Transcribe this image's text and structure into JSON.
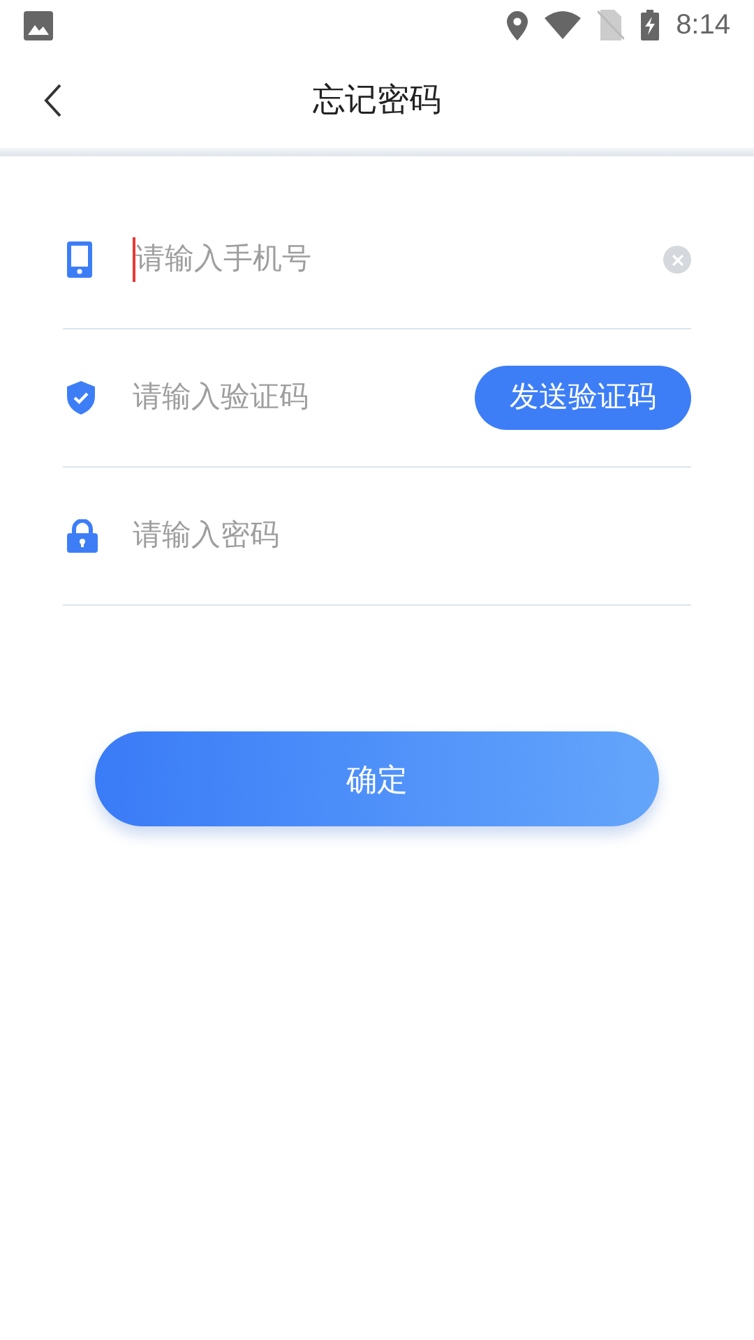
{
  "status_bar": {
    "time": "8:14"
  },
  "header": {
    "title": "忘记密码"
  },
  "fields": [
    {
      "kind": "phone",
      "placeholder": "请输入手机号",
      "focused": true
    },
    {
      "kind": "code",
      "placeholder": "请输入验证码",
      "focused": false,
      "action": "发送验证码"
    },
    {
      "kind": "password",
      "placeholder": "请输入密码",
      "focused": false
    }
  ],
  "submit": "确定"
}
